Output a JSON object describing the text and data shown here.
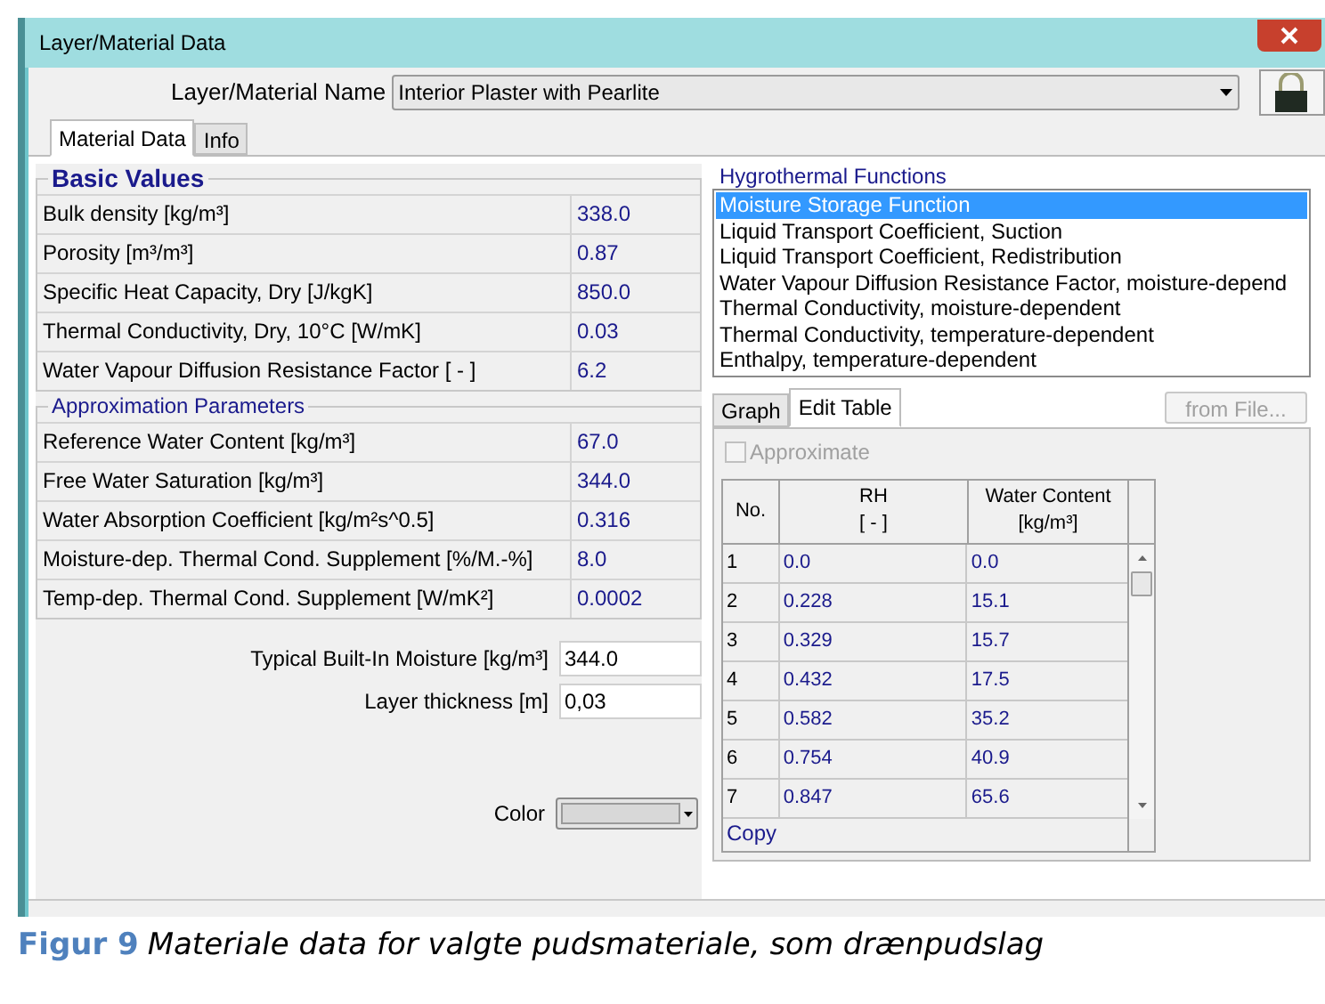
{
  "window": {
    "title": "Layer/Material Data"
  },
  "name_field": {
    "label": "Layer/Material Name",
    "value": "Interior Plaster with Pearlite"
  },
  "tabs": [
    {
      "label": "Material Data",
      "selected": true
    },
    {
      "label": "Info",
      "selected": false
    }
  ],
  "basic_values": {
    "title": "Basic Values",
    "rows": [
      {
        "label": "Bulk density [kg/m³]",
        "value": "338.0"
      },
      {
        "label": "Porosity [m³/m³]",
        "value": "0.87"
      },
      {
        "label": "Specific Heat Capacity, Dry [J/kgK]",
        "value": "850.0"
      },
      {
        "label": "Thermal Conductivity, Dry, 10°C [W/mK]",
        "value": "0.03"
      },
      {
        "label": "Water Vapour Diffusion Resistance Factor [ - ]",
        "value": "6.2"
      }
    ]
  },
  "approximation": {
    "title": "Approximation Parameters",
    "rows": [
      {
        "label": "Reference Water Content [kg/m³]",
        "value": "67.0"
      },
      {
        "label": "Free Water Saturation [kg/m³]",
        "value": "344.0"
      },
      {
        "label": "Water Absorption Coefficient [kg/m²s^0.5]",
        "value": "0.316"
      },
      {
        "label": "Moisture-dep. Thermal Cond. Supplement [%/M.-%]",
        "value": "8.0"
      },
      {
        "label": "Temp-dep. Thermal Cond. Supplement [W/mK²]",
        "value": "0.0002"
      }
    ]
  },
  "fields": [
    {
      "label": "Typical Built-In Moisture [kg/m³]",
      "value": "344.0"
    },
    {
      "label": "Layer thickness [m]",
      "value": "0,03"
    }
  ],
  "color": {
    "label": "Color"
  },
  "hygrothermal": {
    "title": "Hygrothermal Functions",
    "items": [
      {
        "label": "Moisture Storage Function",
        "selected": true
      },
      {
        "label": "Liquid Transport Coefficient, Suction",
        "selected": false
      },
      {
        "label": "Liquid Transport Coefficient, Redistribution",
        "selected": false
      },
      {
        "label": "Water Vapour Diffusion Resistance Factor, moisture-depend",
        "selected": false
      },
      {
        "label": "Thermal Conductivity, moisture-dependent",
        "selected": false
      },
      {
        "label": "Thermal Conductivity, temperature-dependent",
        "selected": false
      },
      {
        "label": "Enthalpy, temperature-dependent",
        "selected": false
      }
    ]
  },
  "subtabs": [
    {
      "label": "Graph",
      "selected": false
    },
    {
      "label": "Edit Table",
      "selected": true
    }
  ],
  "from_file": {
    "label": "from File...",
    "disabled": true
  },
  "approximate": {
    "label": "Approximate",
    "checked": false,
    "disabled": true
  },
  "table": {
    "columns": [
      {
        "label": "No."
      },
      {
        "label": "RH",
        "unit": "[ - ]"
      },
      {
        "label": "Water Content",
        "unit": "[kg/m³]"
      }
    ],
    "rows": [
      [
        "1",
        "0.0",
        "0.0"
      ],
      [
        "2",
        "0.228",
        "15.1"
      ],
      [
        "3",
        "0.329",
        "15.7"
      ],
      [
        "4",
        "0.432",
        "17.5"
      ],
      [
        "5",
        "0.582",
        "35.2"
      ],
      [
        "6",
        "0.754",
        "40.9"
      ],
      [
        "7",
        "0.847",
        "65.6"
      ]
    ],
    "footer": "Copy"
  },
  "caption": {
    "label": "Figur 9",
    "text": "Materiale data for valgte pudsmateriale, som drænpudslag"
  }
}
